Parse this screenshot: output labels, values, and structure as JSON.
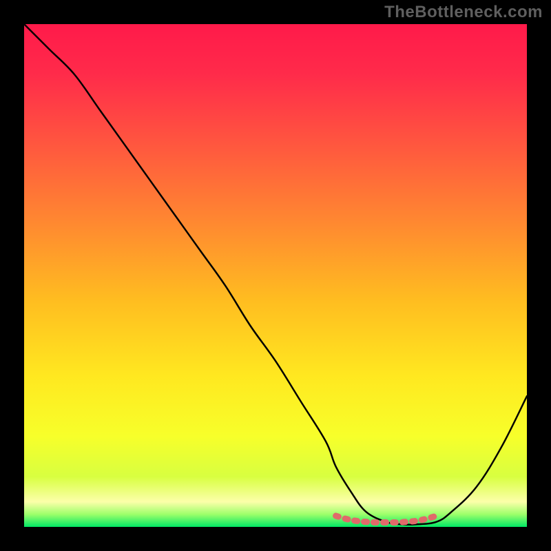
{
  "watermark": "TheBottleneck.com",
  "chart_data": {
    "type": "line",
    "title": "",
    "xlabel": "",
    "ylabel": "",
    "xlim": [
      0,
      100
    ],
    "ylim": [
      0,
      100
    ],
    "series": [
      {
        "name": "bottleneck-curve",
        "x": [
          0,
          5,
          10,
          15,
          20,
          25,
          30,
          35,
          40,
          45,
          50,
          55,
          60,
          62,
          65,
          68,
          72,
          75,
          78,
          82,
          85,
          90,
          95,
          100
        ],
        "values": [
          100,
          95,
          90,
          83,
          76,
          69,
          62,
          55,
          48,
          40,
          33,
          25,
          17,
          12,
          7,
          3,
          1,
          0.5,
          0.5,
          1,
          3,
          8,
          16,
          26
        ]
      },
      {
        "name": "optimal-range-marker",
        "x": [
          62,
          64,
          66,
          68,
          70,
          72,
          74,
          76,
          78,
          80,
          82
        ],
        "values": [
          2.2,
          1.6,
          1.2,
          1.0,
          0.9,
          0.9,
          0.9,
          1.0,
          1.2,
          1.6,
          2.2
        ]
      }
    ],
    "gradient_stops": [
      {
        "offset": 0,
        "color": "#ff1a4a"
      },
      {
        "offset": 0.1,
        "color": "#ff2b4a"
      },
      {
        "offset": 0.25,
        "color": "#ff5a3e"
      },
      {
        "offset": 0.4,
        "color": "#ff8a30"
      },
      {
        "offset": 0.55,
        "color": "#ffbd20"
      },
      {
        "offset": 0.7,
        "color": "#ffe820"
      },
      {
        "offset": 0.82,
        "color": "#f7ff2a"
      },
      {
        "offset": 0.9,
        "color": "#d8ff40"
      },
      {
        "offset": 0.95,
        "color": "#fcffaa"
      },
      {
        "offset": 0.975,
        "color": "#9dff6a"
      },
      {
        "offset": 1.0,
        "color": "#00e865"
      }
    ],
    "curve_color": "#000000",
    "marker_color": "#e06a6a"
  }
}
